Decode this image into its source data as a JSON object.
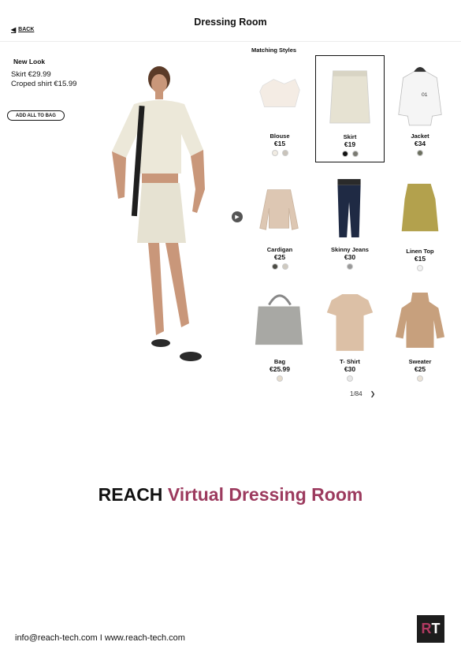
{
  "header": {
    "back_label": "BACK",
    "title": "Dressing Room"
  },
  "look": {
    "title": "New Look",
    "items": [
      "Skirt €29.99",
      "Croped shirt €15.99"
    ],
    "add_all_label": "ADD ALL TO BAG"
  },
  "matching": {
    "title": "Matching Styles",
    "products": [
      {
        "name": "Blouse",
        "price": "€15",
        "swatches": [
          "#f1ece3",
          "#c9c3ba"
        ],
        "selected": false,
        "icon": "blouse-icon"
      },
      {
        "name": "Skirt",
        "price": "€19",
        "swatches": [
          "#111111",
          "#7a7a72"
        ],
        "selected": true,
        "icon": "skirt-icon"
      },
      {
        "name": "Jacket",
        "price": "€34",
        "swatches": [
          "#6b6f5e"
        ],
        "selected": false,
        "icon": "jacket-icon"
      },
      {
        "name": "Cardigan",
        "price": "€25",
        "swatches": [
          "#4b4b44",
          "#cfcac0"
        ],
        "selected": false,
        "icon": "cardigan-icon"
      },
      {
        "name": "Skinny Jeans",
        "price": "€30",
        "swatches": [
          "#9a9a9a"
        ],
        "selected": false,
        "icon": "jeans-icon"
      },
      {
        "name": "Linen Top",
        "price": "€15",
        "swatches": [
          "#f2f2f2"
        ],
        "selected": false,
        "icon": "linen-top-icon"
      },
      {
        "name": "Bag",
        "price": "€25.99",
        "swatches": [
          "#e6dccd"
        ],
        "selected": false,
        "icon": "bag-icon"
      },
      {
        "name": "T- Shirt",
        "price": "€30",
        "swatches": [
          "#e8e8e8"
        ],
        "selected": false,
        "icon": "tshirt-icon"
      },
      {
        "name": "Sweater",
        "price": "€25",
        "swatches": [
          "#ece4d8"
        ],
        "selected": false,
        "icon": "sweater-icon"
      }
    ]
  },
  "pager": {
    "label": "1/84"
  },
  "banner": {
    "brand": "REACH",
    "tagline": "Virtual Dressing Room"
  },
  "footer": {
    "contact": "info@reach-tech.com I www.reach-tech.com",
    "logo_r": "R",
    "logo_t": "T"
  },
  "colors": {
    "accent": "#9c3a5e",
    "logo_bg": "#1d1d1d"
  }
}
